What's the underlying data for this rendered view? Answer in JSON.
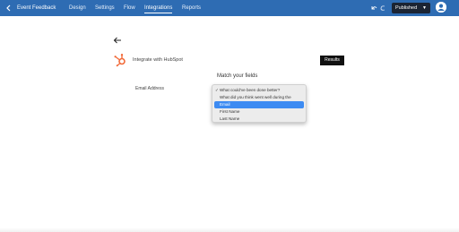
{
  "header": {
    "back_icon": "back-icon",
    "app_title": "Event Feedback",
    "tabs": [
      "Design",
      "Settings",
      "Flow",
      "Integrations",
      "Reports"
    ],
    "active_tab": "Integrations",
    "publish_label": "Published",
    "brand_color": "#2e6cb3"
  },
  "page": {
    "integrate_title": "Integrate with HubSpot",
    "results_label": "Results",
    "match_heading": "Match your fields",
    "field_label": "Email Address"
  },
  "dropdown": {
    "options": [
      "What could've been done better?",
      "What did you think went well during the retreat?",
      "Email",
      "First Name",
      "Last Name"
    ],
    "checked_index": 0,
    "highlighted_index": 2,
    "highlight_color": "#3d8bf2"
  }
}
